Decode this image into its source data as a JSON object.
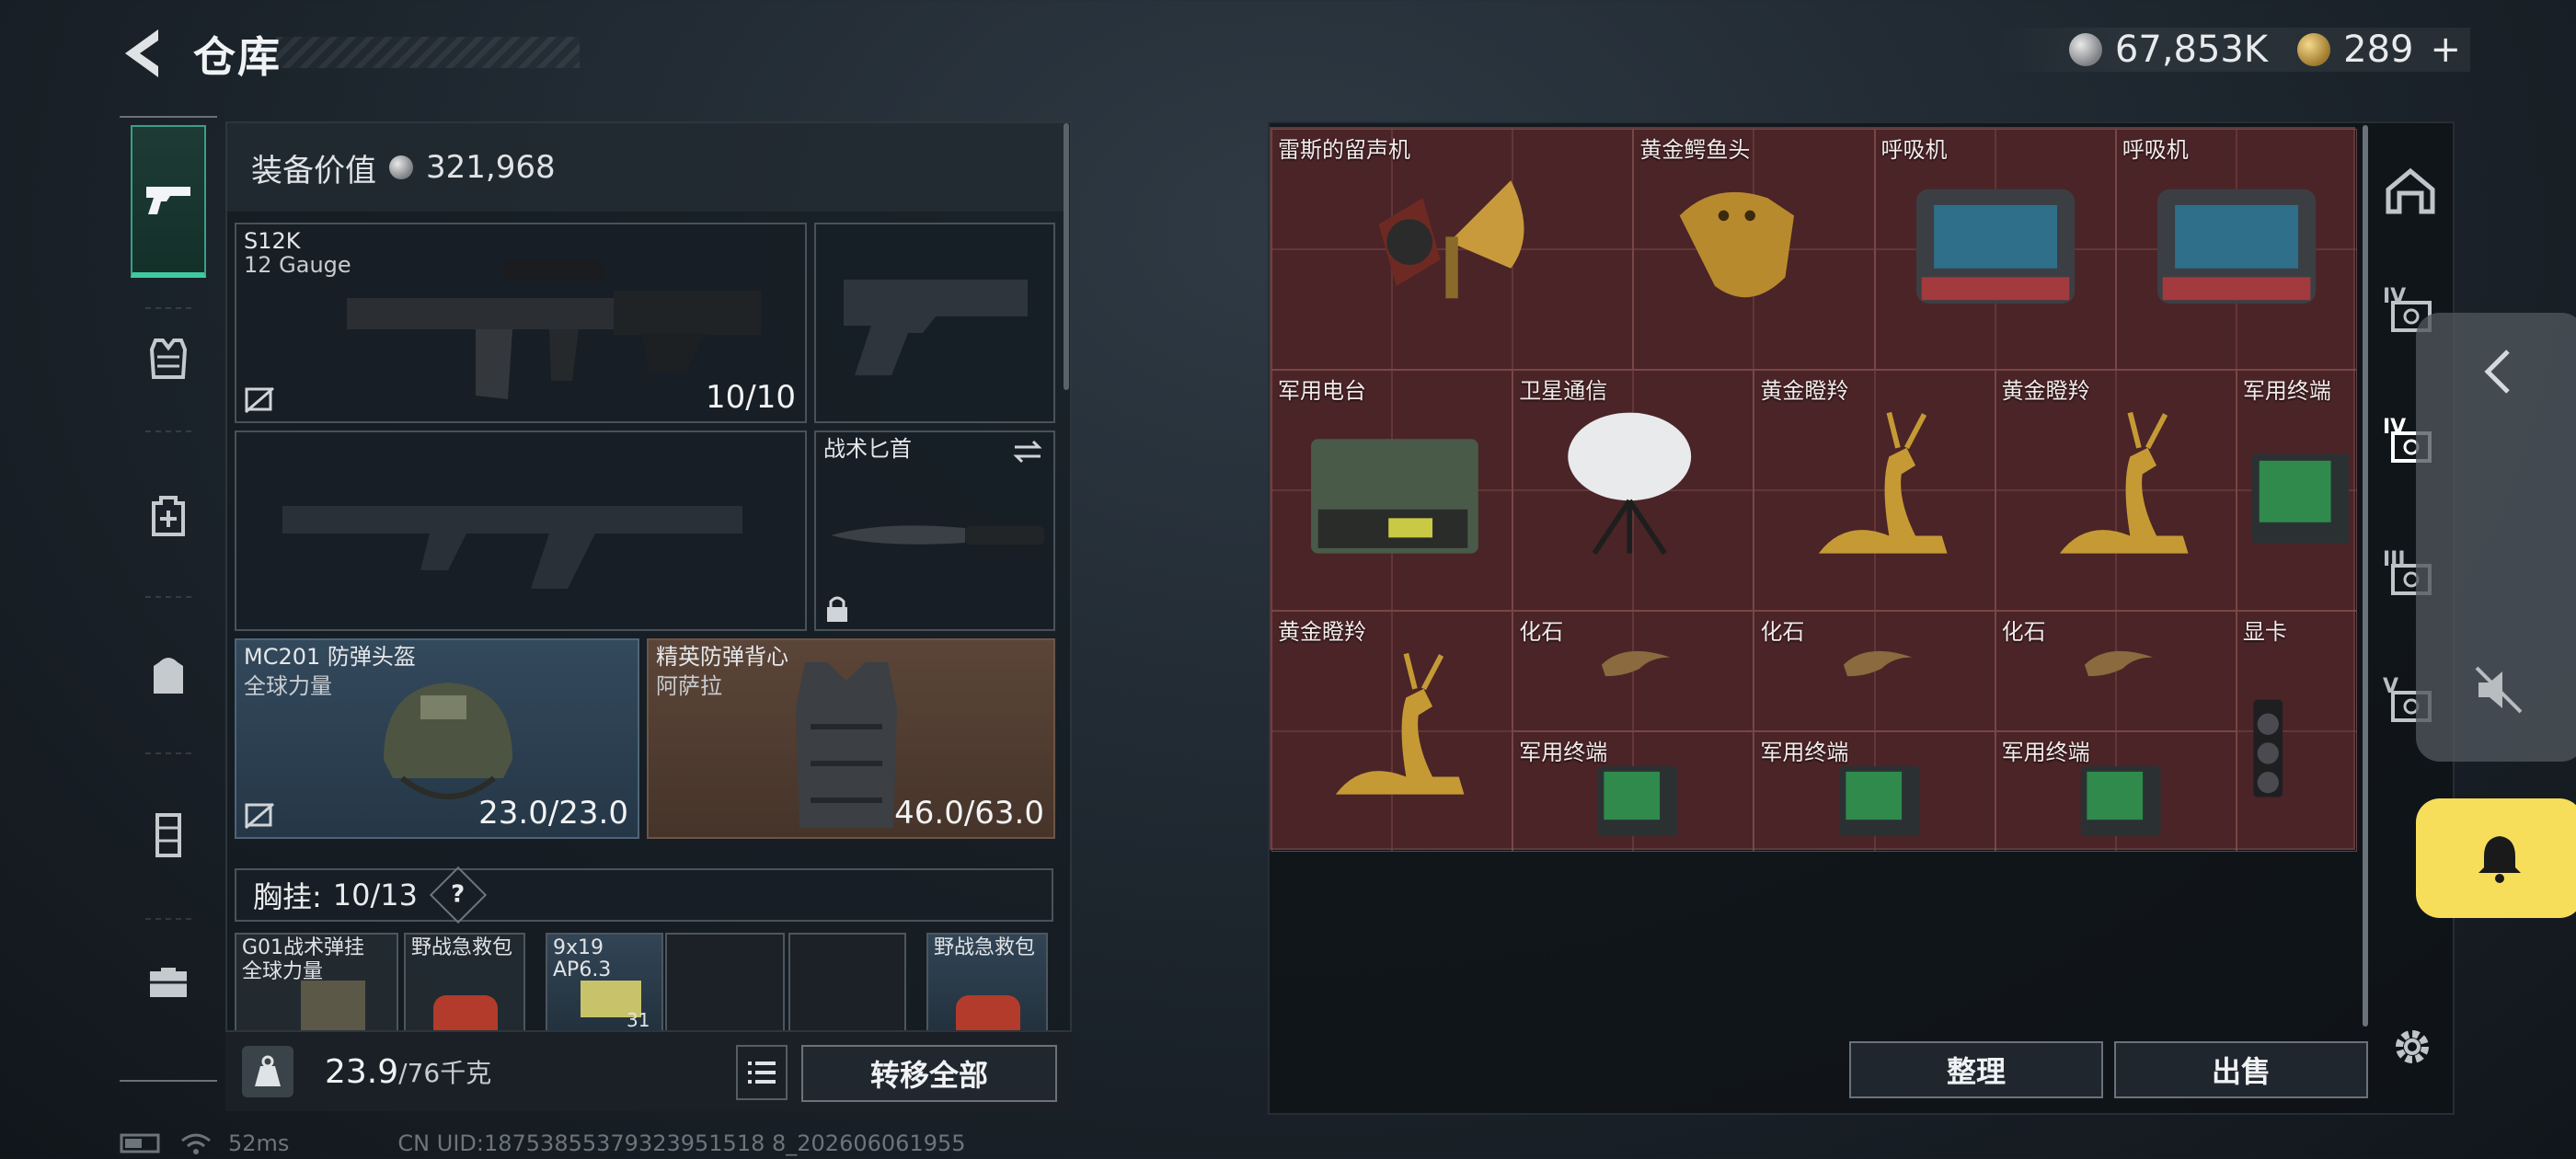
{
  "header": {
    "title": "仓库",
    "silver_amount": "67,853K",
    "gold_amount": "289",
    "add_label": "+"
  },
  "loadout": {
    "value_label": "装备价值",
    "value": "321,968",
    "primary": {
      "name": "S12K",
      "caliber": "12 Gauge",
      "ammo": "10/10"
    },
    "knife": {
      "name": "战术匕首"
    },
    "helmet": {
      "name": "MC201 防弹头盔",
      "sub": "全球力量",
      "durability": "23.0/23.0"
    },
    "armor": {
      "name": "精英防弹背心",
      "sub": "阿萨拉",
      "durability": "46.0/63.0"
    },
    "rig": {
      "label": "胸挂:",
      "count": "10/13",
      "help": "?"
    },
    "rig_items": [
      {
        "name": "G01战术弹挂",
        "sub": "全球力量"
      },
      {
        "name": "野战急救包"
      },
      {
        "name": "9x19",
        "sub": "AP6.3",
        "count": "31"
      },
      {
        "name": "野战急救包"
      }
    ]
  },
  "weight": {
    "current": "23.9",
    "max": "/76千克"
  },
  "actions": {
    "transfer_all": "转移全部",
    "sort": "整理",
    "sell": "出售"
  },
  "storage": {
    "items": [
      {
        "name": "雷斯的留声机",
        "art": "gramophone"
      },
      {
        "name": "黄金鳄鱼头",
        "art": "croc"
      },
      {
        "name": "呼吸机",
        "art": "ventilator"
      },
      {
        "name": "呼吸机",
        "art": "ventilator"
      },
      {
        "name": "军用电台",
        "art": "radio"
      },
      {
        "name": "卫星通信",
        "art": "satellite"
      },
      {
        "name": "黄金瞪羚",
        "art": "gazelle"
      },
      {
        "name": "黄金瞪羚",
        "art": "gazelle"
      },
      {
        "name": "军用终端",
        "art": "terminal"
      },
      {
        "name": "黄金瞪羚",
        "art": "gazelle"
      },
      {
        "name": "化石",
        "art": "fossil"
      },
      {
        "name": "化石",
        "art": "fossil"
      },
      {
        "name": "化石",
        "art": "fossil"
      },
      {
        "name": "显卡",
        "art": "gpu"
      },
      {
        "name": "军用终端",
        "art": "terminal"
      },
      {
        "name": "军用终端",
        "art": "terminal"
      },
      {
        "name": "军用终端",
        "art": "terminal"
      }
    ]
  },
  "side_tabs": [
    "IV",
    "IV",
    "III",
    "V"
  ],
  "status": {
    "ping": "52ms",
    "uid": "CN UID:18753855379323951518 8_202606061955"
  },
  "colors": {
    "accent_green": "#3fc9a1",
    "storage_bg": "#4b2427",
    "notify_yellow": "#f6de5a"
  }
}
